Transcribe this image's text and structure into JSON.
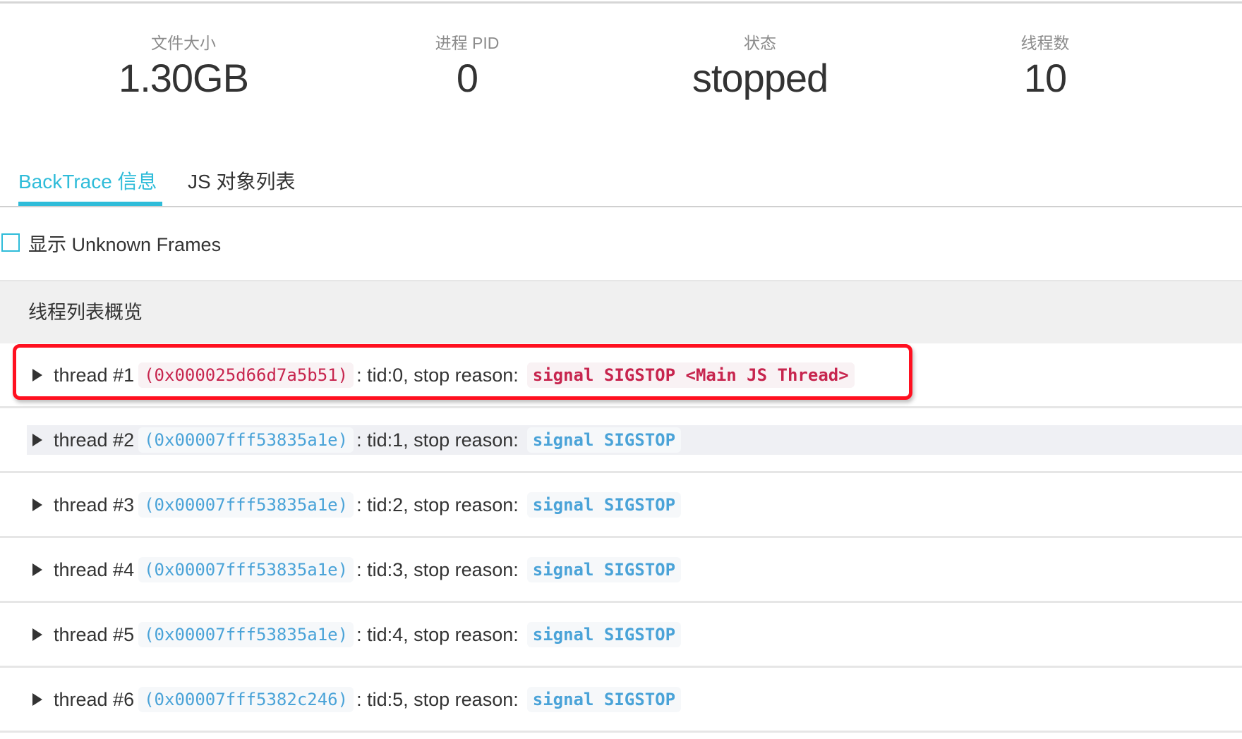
{
  "stats": [
    {
      "label": "文件大小",
      "value": "1.30GB"
    },
    {
      "label": "进程 PID",
      "value": "0"
    },
    {
      "label": "状态",
      "value": "stopped"
    },
    {
      "label": "线程数",
      "value": "10"
    }
  ],
  "tabs": [
    {
      "label": "BackTrace 信息",
      "active": true
    },
    {
      "label": "JS 对象列表",
      "active": false
    }
  ],
  "options": {
    "show_unknown_frames_label": "显示 Unknown Frames",
    "show_unknown_frames_checked": false
  },
  "section": {
    "title": "线程列表概览"
  },
  "labels": {
    "tid_prefix": ": tid: ",
    "stop_reason_prefix": ", stop reason: "
  },
  "threads": [
    {
      "name": "thread #1",
      "address": "(0x000025d66d7a5b51)",
      "tid": "0",
      "stop_reason": "signal SIGSTOP <Main JS Thread>",
      "highlighted": true
    },
    {
      "name": "thread #2",
      "address": "(0x00007fff53835a1e)",
      "tid": "1",
      "stop_reason": "signal SIGSTOP",
      "highlighted": false
    },
    {
      "name": "thread #3",
      "address": "(0x00007fff53835a1e)",
      "tid": "2",
      "stop_reason": "signal SIGSTOP",
      "highlighted": false
    },
    {
      "name": "thread #4",
      "address": "(0x00007fff53835a1e)",
      "tid": "3",
      "stop_reason": "signal SIGSTOP",
      "highlighted": false
    },
    {
      "name": "thread #5",
      "address": "(0x00007fff53835a1e)",
      "tid": "4",
      "stop_reason": "signal SIGSTOP",
      "highlighted": false
    },
    {
      "name": "thread #6",
      "address": "(0x00007fff5382c246)",
      "tid": "5",
      "stop_reason": "signal SIGSTOP",
      "highlighted": false
    }
  ],
  "colors": {
    "accent": "#2fbcd9",
    "highlight_border": "#ff1020",
    "main_thread_code": "#c7254e",
    "thread_code": "#4aa3d8"
  }
}
